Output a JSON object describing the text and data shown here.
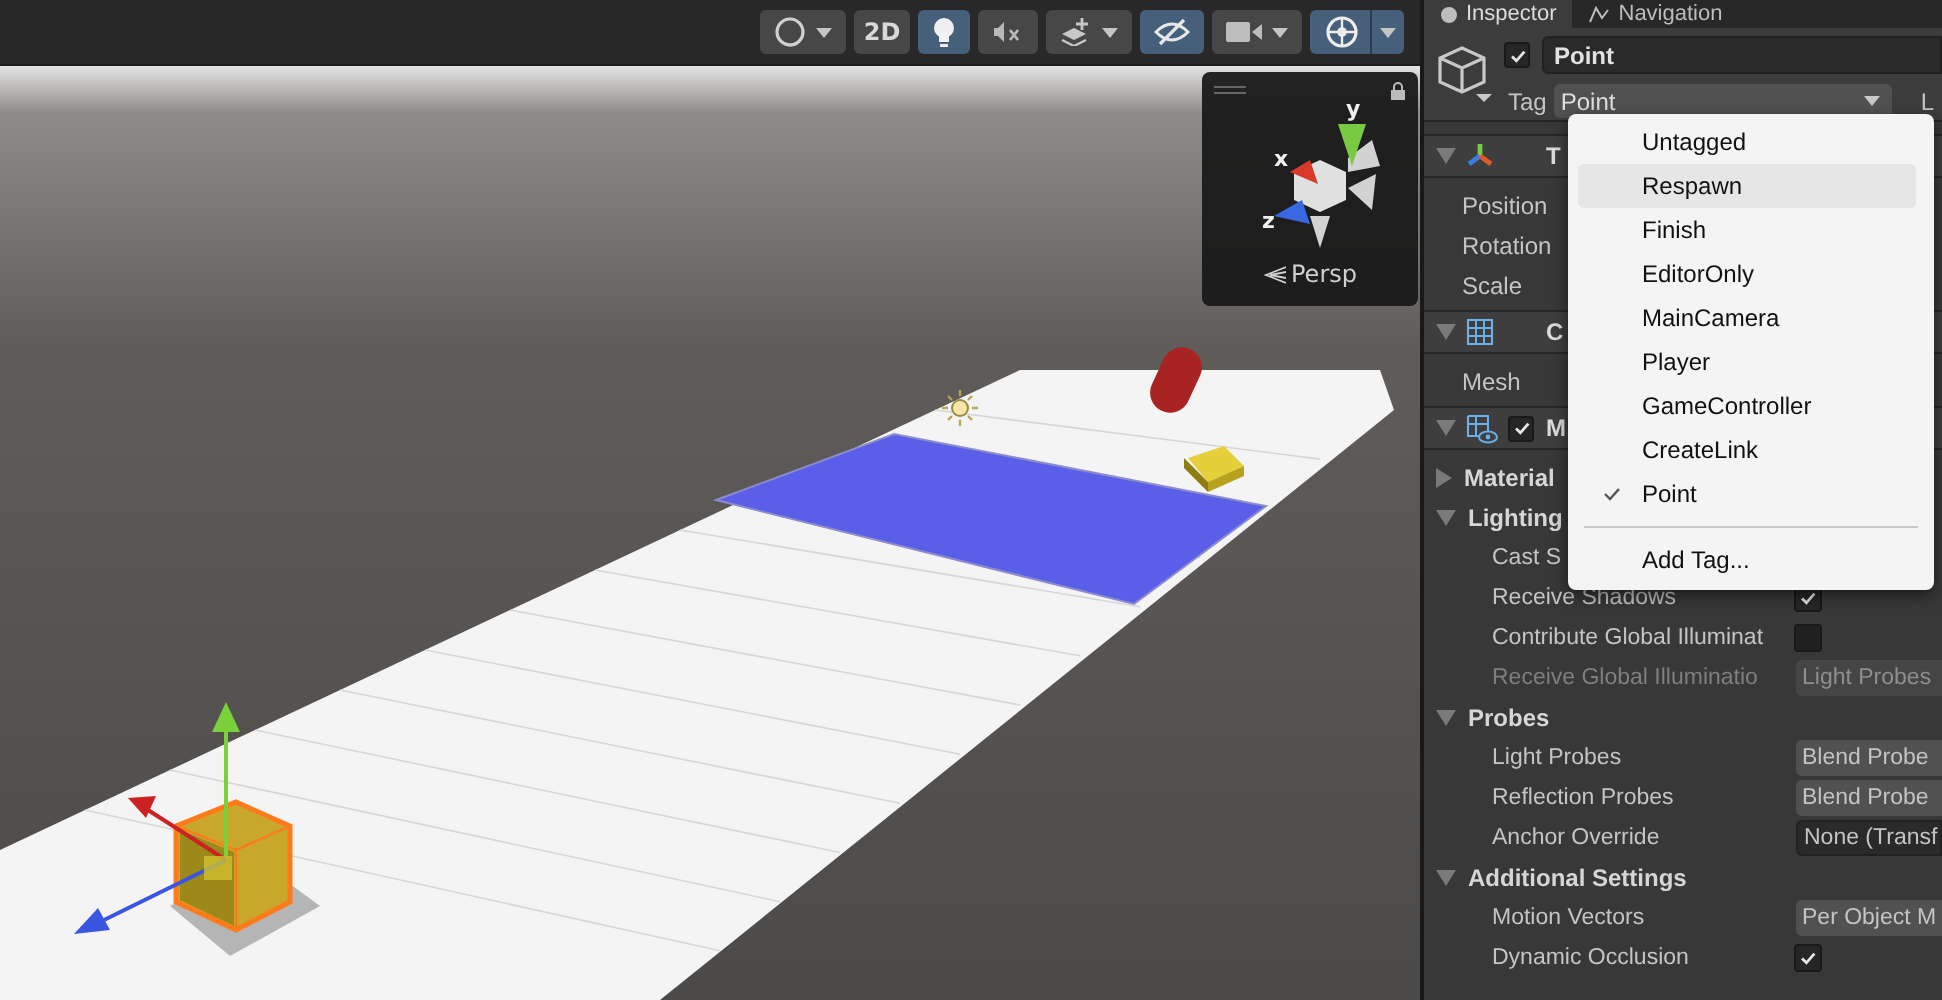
{
  "toolbar": {
    "buttons": [
      {
        "kind": "shading",
        "on": false,
        "dropdown": true
      },
      {
        "kind": "dimension",
        "label": "2D",
        "on": false,
        "dropdown": false
      },
      {
        "kind": "lighting",
        "on": true,
        "dropdown": false
      },
      {
        "kind": "audio",
        "on": false,
        "dropdown": false
      },
      {
        "kind": "effects",
        "on": false,
        "dropdown": true
      },
      {
        "kind": "visibility",
        "on": true,
        "dropdown": false
      },
      {
        "kind": "camera",
        "on": false,
        "dropdown": true
      },
      {
        "kind": "gizmos",
        "on": true,
        "dropdown": true
      }
    ]
  },
  "scene": {
    "orientation_gizmo": {
      "axes": [
        {
          "label": "y",
          "color": "#7ac943"
        },
        {
          "label": "x",
          "color": "#d83a2a"
        },
        {
          "label": "z",
          "color": "#3868e0"
        }
      ],
      "projection": "Persp"
    }
  },
  "inspector": {
    "tabs": [
      {
        "label": "Inspector",
        "selected": true
      },
      {
        "label": "Navigation",
        "selected": false
      }
    ],
    "object": {
      "enabled": true,
      "name": "Point",
      "tag_label": "Tag",
      "tag": "Point",
      "layer_label": "L"
    },
    "tag_menu": {
      "items": [
        {
          "label": "Untagged",
          "selected": false,
          "highlighted": false
        },
        {
          "label": "Respawn",
          "selected": false,
          "highlighted": true
        },
        {
          "label": "Finish",
          "selected": false,
          "highlighted": false
        },
        {
          "label": "EditorOnly",
          "selected": false,
          "highlighted": false
        },
        {
          "label": "MainCamera",
          "selected": false,
          "highlighted": false
        },
        {
          "label": "Player",
          "selected": false,
          "highlighted": false
        },
        {
          "label": "GameController",
          "selected": false,
          "highlighted": false
        },
        {
          "label": "CreateLink",
          "selected": false,
          "highlighted": false
        },
        {
          "label": "Point",
          "selected": true,
          "highlighted": false
        }
      ],
      "action": "Add Tag..."
    },
    "components": [
      {
        "title": "T",
        "expanded": true,
        "rows": [
          {
            "kind": "label",
            "label": "Position"
          },
          {
            "kind": "label",
            "label": "Rotation"
          },
          {
            "kind": "label",
            "label": "Scale"
          }
        ]
      },
      {
        "title": "C",
        "expanded": true,
        "rows": [
          {
            "kind": "label",
            "label": "Mesh"
          }
        ]
      },
      {
        "title": "M",
        "expanded": true,
        "enabled": true,
        "rows": [
          {
            "kind": "section",
            "label": "Material",
            "expanded": false
          },
          {
            "kind": "section",
            "label": "Lighting",
            "expanded": true
          },
          {
            "kind": "sublabel",
            "label": "Cast S"
          },
          {
            "kind": "checkbox",
            "label": "Receive Shadows",
            "checked": true
          },
          {
            "kind": "checkbox",
            "label": "Contribute Global Illuminat",
            "checked": false
          },
          {
            "kind": "field",
            "label": "Receive Global Illuminatio",
            "value": "Light Probes",
            "disabled": true
          },
          {
            "kind": "section",
            "label": "Probes",
            "expanded": true
          },
          {
            "kind": "field",
            "label": "Light Probes",
            "value": "Blend Probe",
            "disabled": false
          },
          {
            "kind": "field",
            "label": "Reflection Probes",
            "value": "Blend Probe",
            "disabled": false
          },
          {
            "kind": "object",
            "label": "Anchor Override",
            "value": "None (Transf",
            "disabled": false
          },
          {
            "kind": "section",
            "label": "Additional Settings",
            "expanded": true
          },
          {
            "kind": "field",
            "label": "Motion Vectors",
            "value": "Per Object M",
            "disabled": false
          },
          {
            "kind": "checkbox",
            "label": "Dynamic Occlusion",
            "checked": true
          }
        ]
      }
    ]
  }
}
